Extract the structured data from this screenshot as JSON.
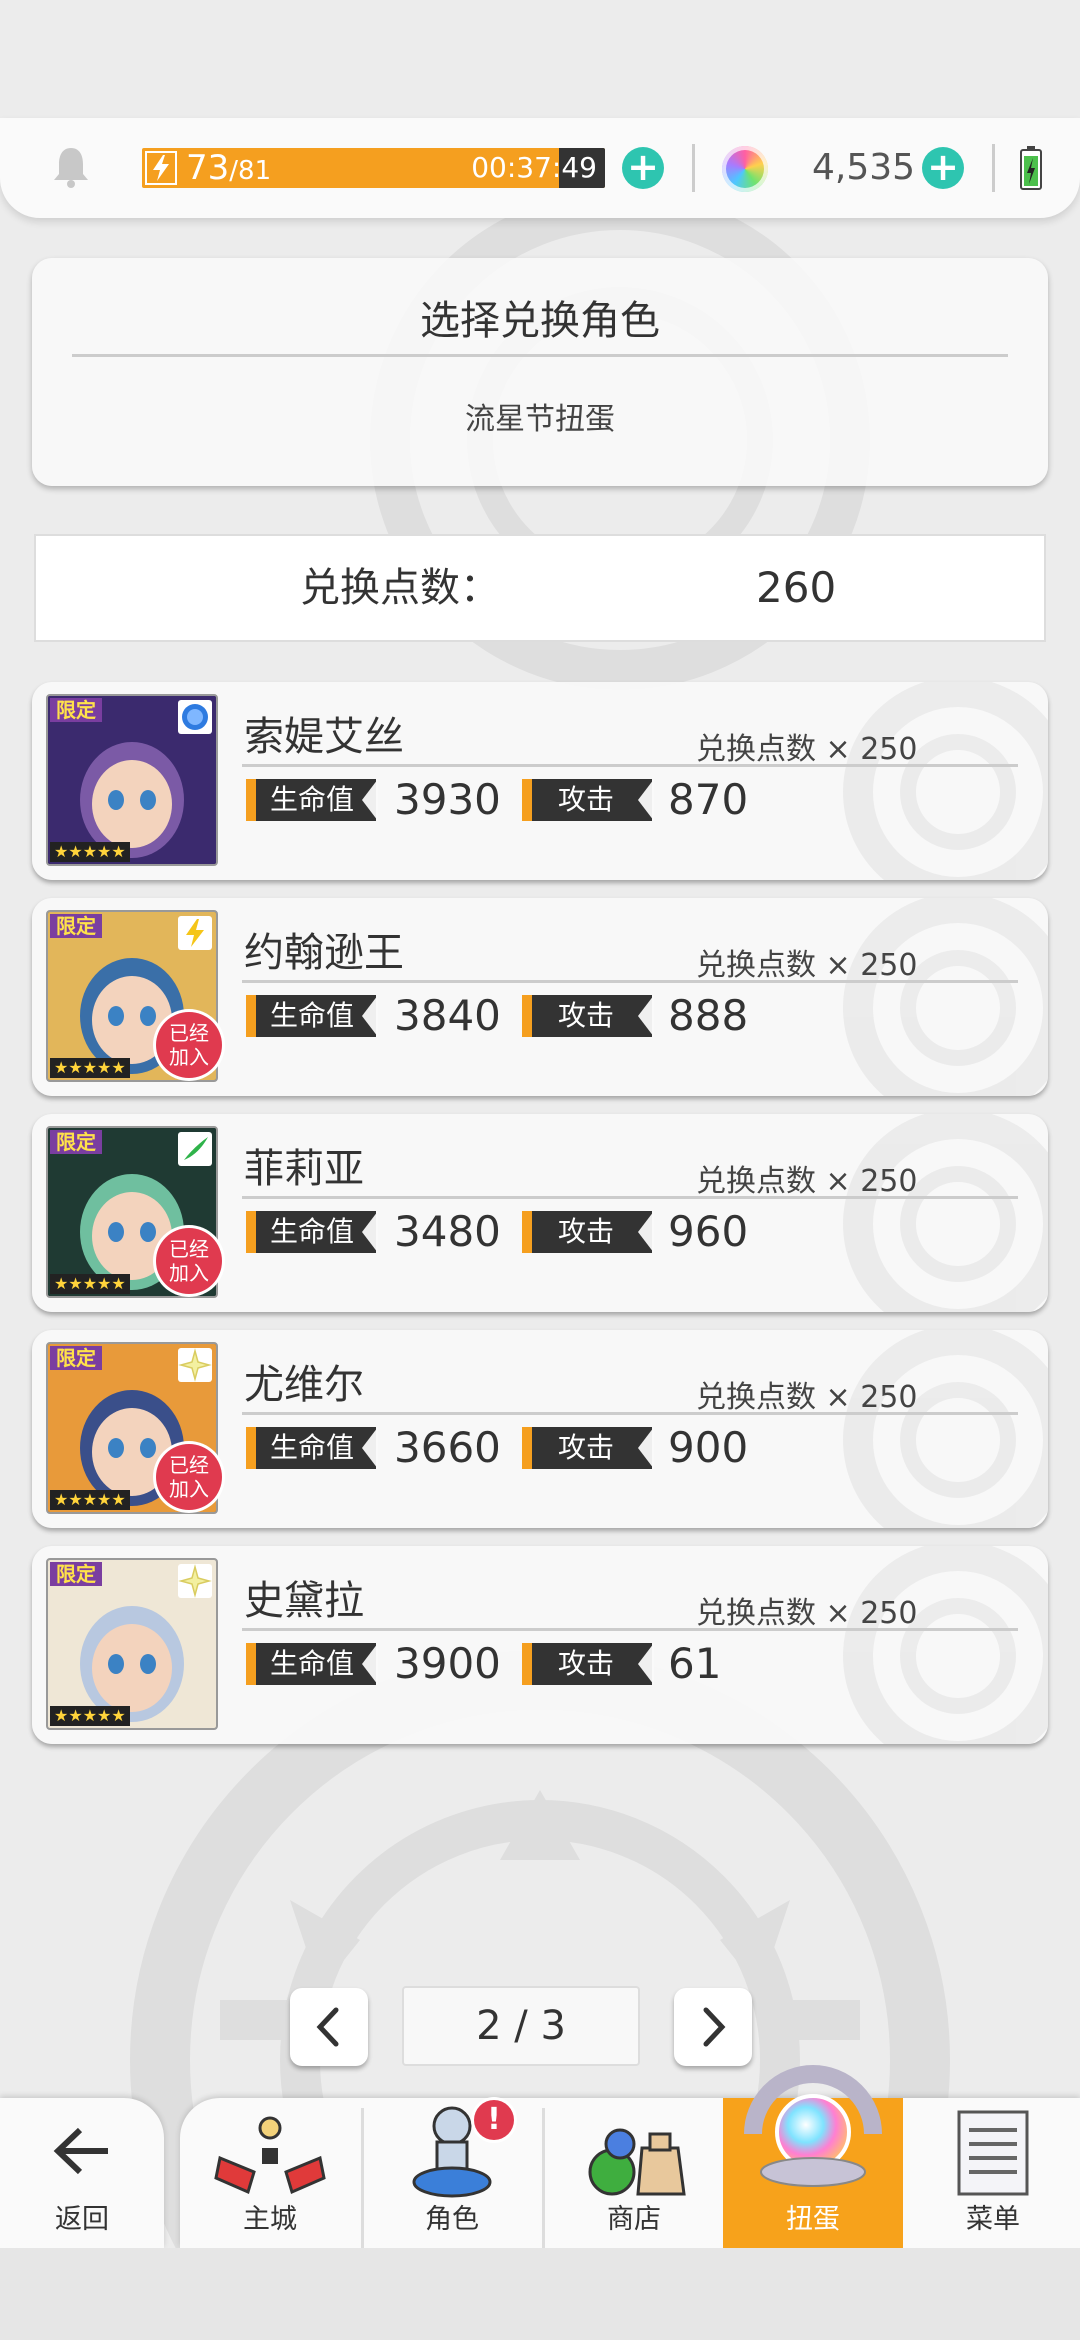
{
  "status_bar": {
    "stamina_current": "73",
    "stamina_max": "/81",
    "stamina_fill": 0.9,
    "timer": "00:37:49",
    "gems": "4,535"
  },
  "panel": {
    "title": "选择兑换角色",
    "subtitle": "流星节扭蛋"
  },
  "points": {
    "label": "兑换点数：",
    "value": "260"
  },
  "labels": {
    "limited": "限定",
    "stars": "★★★★★",
    "hp": "生命值",
    "atk": "攻击",
    "joined_line1": "已经",
    "joined_line2": "加入"
  },
  "characters": [
    {
      "name": "索媞艾丝",
      "cost": "兑换点数 × 250",
      "hp": "3930",
      "atk": "870",
      "element": "water",
      "joined": false
    },
    {
      "name": "约翰逊王",
      "cost": "兑换点数 × 250",
      "hp": "3840",
      "atk": "888",
      "element": "thunder",
      "joined": true
    },
    {
      "name": "菲莉亚",
      "cost": "兑换点数 × 250",
      "hp": "3480",
      "atk": "960",
      "element": "wind",
      "joined": true
    },
    {
      "name": "尤维尔",
      "cost": "兑换点数 × 250",
      "hp": "3660",
      "atk": "900",
      "element": "light",
      "joined": true
    },
    {
      "name": "史黛拉",
      "cost": "兑换点数 × 250",
      "hp": "3900",
      "atk": "61",
      "element": "light",
      "joined": false
    }
  ],
  "pager": {
    "text": "2 / 3"
  },
  "nav": {
    "back": "返回",
    "tabs": [
      {
        "label": "主城",
        "icon": "castle-icon"
      },
      {
        "label": "角色",
        "icon": "character-icon",
        "badge": "!"
      },
      {
        "label": "商店",
        "icon": "shop-icon"
      },
      {
        "label": "扭蛋",
        "icon": "gacha-icon",
        "active": true
      },
      {
        "label": "菜单",
        "icon": "menu-list-icon"
      }
    ]
  },
  "colors": {
    "accent_orange": "#f59f1f",
    "plus_teal": "#2ec5b0",
    "badge_red": "#e03a4f"
  }
}
